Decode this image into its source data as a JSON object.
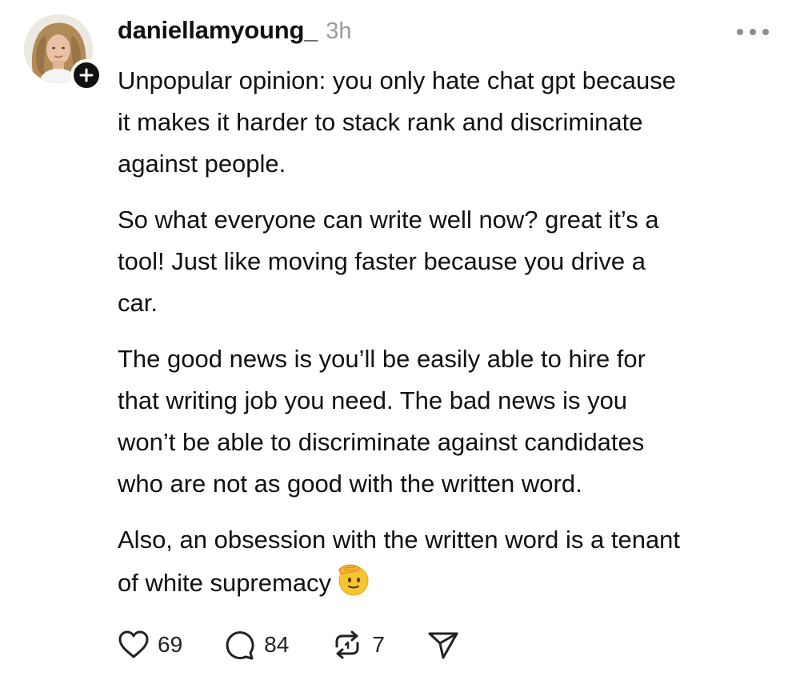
{
  "post": {
    "username": "daniellamyoung_",
    "timestamp": "3h",
    "paragraphs": [
      "Unpopular opinion: you only hate chat gpt because\nit makes it harder to stack rank and discriminate\nagainst people.",
      "So what everyone can write well now? great it’s a\ntool! Just like moving faster because you drive a\ncar.",
      "The good news is you’ll be easily able to hire for\nthat writing job you need. The bad news is you\nwon’t be able to discriminate against candidates\nwho are not as good with the written word.",
      "Also, an obsession with the written word is a tenant\nof white supremacy"
    ],
    "emoji": "saluting-face"
  },
  "actions": {
    "likes": "69",
    "replies": "84",
    "reposts": "7"
  },
  "icons": {
    "more": "more-horizontal-icon",
    "like": "heart-icon",
    "reply": "comment-bubble-icon",
    "repost": "repost-icon",
    "share": "send-icon",
    "follow": "plus-icon"
  },
  "colors": {
    "text": "#111111",
    "muted": "#9b9b9b",
    "emoji": "#f7c531"
  }
}
